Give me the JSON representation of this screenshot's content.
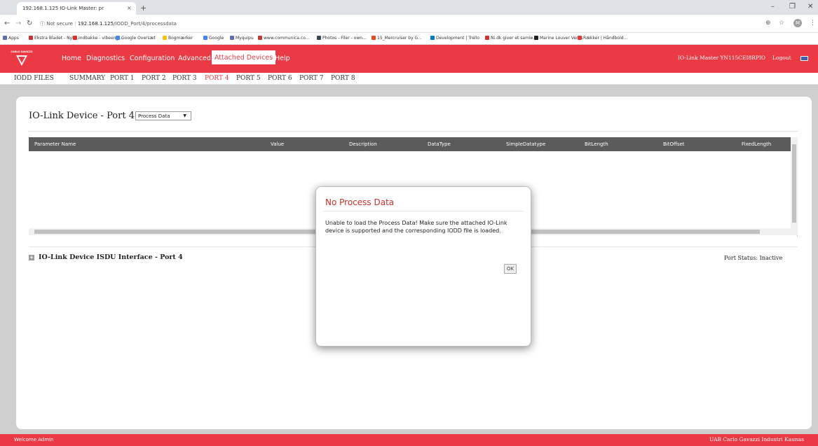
{
  "browser": {
    "tab_title": "192.168.1.125 IO-Link Master: pr",
    "tab_close": "×",
    "new_tab": "+",
    "minimize": "–",
    "restore": "❐",
    "close": "✕",
    "url_secure_label": "Not secure",
    "url_host": "192.168.1.125",
    "url_path": "/IODD_Port/4/processdata",
    "profile_initial": "M",
    "bookmarks": [
      {
        "label": "Apps",
        "color": "#5b6fb0"
      },
      {
        "label": "Ekstra Bladet - Nyh...",
        "color": "#d32f2f"
      },
      {
        "label": "Indbakke - vibeeng...",
        "color": "#d93025"
      },
      {
        "label": "Google Oversæt",
        "color": "#4285f4"
      },
      {
        "label": "Bogmærker",
        "color": "#f4c20d"
      },
      {
        "label": "Google",
        "color": "#4285f4"
      },
      {
        "label": "Myquipu",
        "color": "#5b6fb0"
      },
      {
        "label": "www.communica.co...",
        "color": "#c0392b"
      },
      {
        "label": "Photos - Filer - own...",
        "color": "#37474f"
      },
      {
        "label": "15_Mercruiser by G...",
        "color": "#e64a19"
      },
      {
        "label": "Development | Trello",
        "color": "#0079bf"
      },
      {
        "label": "Ni.dk giver et samle...",
        "color": "#d32f2f"
      },
      {
        "label": "Marine Louver Vents",
        "color": "#212121"
      },
      {
        "label": "Rækker | Håndbold...",
        "color": "#e53935"
      }
    ]
  },
  "app": {
    "logo_text": "CARLO GAVAZZI",
    "nav": [
      "Home",
      "Diagnostics",
      "Configuration",
      "Advanced",
      "Attached Devices",
      "Help"
    ],
    "master_title": "IO-Link Master YN115CEI8RPIO",
    "logout": "Logout",
    "subnav": [
      "IODD FILES",
      "SUMMARY",
      "PORT 1",
      "PORT 2",
      "PORT 3",
      "PORT 4",
      "PORT 5",
      "PORT 6",
      "PORT 7",
      "PORT 8"
    ],
    "active_subnav": "PORT 4"
  },
  "panel": {
    "title": "IO-Link Device - Port 4",
    "select_value": "Process Data",
    "columns": [
      "Parameter Name",
      "Value",
      "Description",
      "DataType",
      "SimpleDatatype",
      "BitLength",
      "BitOffset",
      "FixedLength"
    ],
    "isdu_label": "IO-Link Device ISDU Interface - Port 4",
    "port_status": "Port Status: Inactive"
  },
  "modal": {
    "title": "No Process Data",
    "body": "Unable to load the Process Data! Make sure the attached IO-Link device is supported and the corresponding IODD file is loaded.",
    "ok": "OK"
  },
  "footer": {
    "left": "Welcome Admin",
    "right": "UAB Carlo Gavazzi Industri Kaunas"
  },
  "colors": {
    "brand": "#ec3a45",
    "table_header": "#5b5b5b",
    "modal_title": "#c9302c"
  }
}
